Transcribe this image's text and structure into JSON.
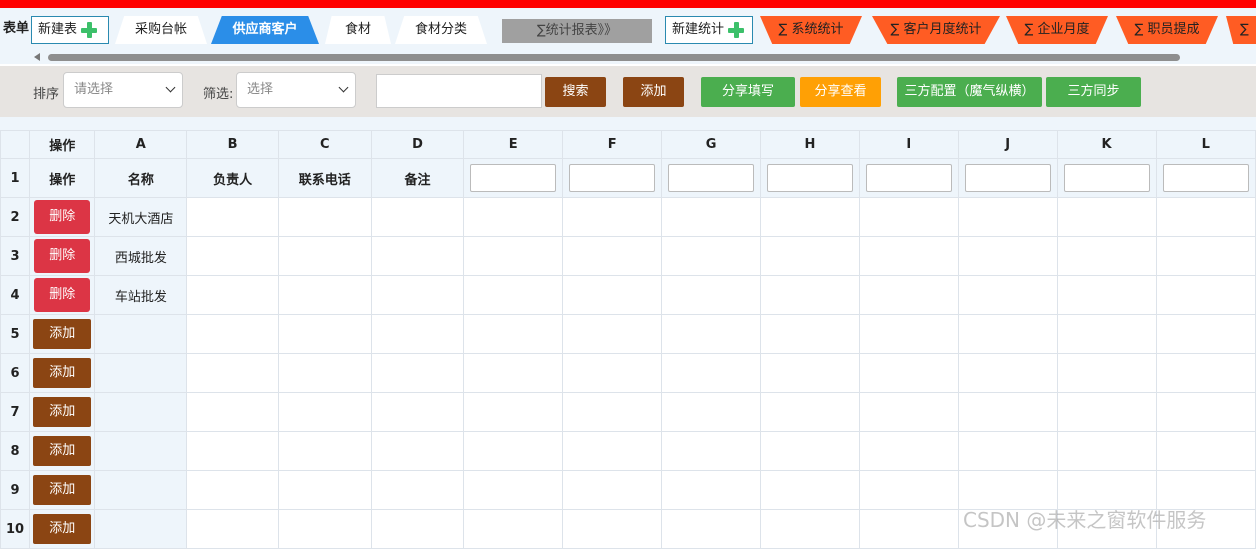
{
  "tabs": {
    "form_label": "表单",
    "new_form_label": "新建表",
    "items": [
      "采购台帐",
      "供应商客户",
      "食材",
      "食材分类"
    ],
    "stats_report_label": "∑统计报表》》",
    "new_stats_label": "新建统计",
    "stat_tabs": [
      "∑ 系统统计",
      "∑ 客户月度统计",
      "∑ 企业月度",
      "∑ 职员提成",
      "∑"
    ]
  },
  "toolbar": {
    "sort_label": "排序",
    "sort_placeholder": "请选择",
    "filter_label": "筛选:",
    "filter_placeholder": "选择",
    "search_label": "搜索",
    "add_label": "添加",
    "share_fill_label": "分享填写",
    "share_view_label": "分享查看",
    "third_party_config_label": "三方配置（魔气纵横）",
    "third_party_sync_label": "三方同步"
  },
  "grid": {
    "op_header": "操作",
    "column_letters": [
      "A",
      "B",
      "C",
      "D",
      "E",
      "F",
      "G",
      "H",
      "I",
      "J",
      "K",
      "L"
    ],
    "row1_number": "1",
    "row1_headers": [
      "操作",
      "名称",
      "负责人",
      "联系电话",
      "备注"
    ],
    "delete_label": "删除",
    "add_label": "添加",
    "rows": [
      {
        "num": "2",
        "name": "天机大酒店"
      },
      {
        "num": "3",
        "name": "西城批发"
      },
      {
        "num": "4",
        "name": "车站批发"
      },
      {
        "num": "5",
        "name": ""
      },
      {
        "num": "6",
        "name": ""
      },
      {
        "num": "7",
        "name": ""
      },
      {
        "num": "8",
        "name": ""
      },
      {
        "num": "9",
        "name": ""
      },
      {
        "num": "10",
        "name": ""
      }
    ]
  },
  "watermark": "CSDN @未来之窗软件服务",
  "colors": {
    "top_bar": "#ff0000",
    "active_tab": "#2b8ee8",
    "stat_tab": "#ff5c23",
    "brown_button": "#8b4513",
    "green_button": "#4bae4f",
    "orange_button": "#ffa005",
    "delete_button": "#dc3545"
  }
}
